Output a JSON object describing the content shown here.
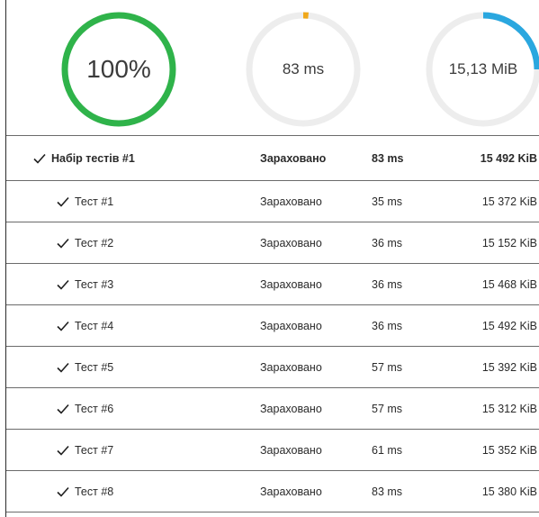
{
  "summary": {
    "tests": {
      "label": "100%",
      "fraction": 1.0,
      "color": "#2fb34a"
    },
    "time": {
      "label": "83 ms",
      "fraction": 0.015,
      "color": "#f0a81a"
    },
    "memory": {
      "label": "15,13 MiB",
      "fraction": 0.25,
      "color": "#2aa7df"
    },
    "track_color": "#ededed"
  },
  "group": {
    "icon": "check-icon",
    "name": "Набір тестів #1",
    "status": "Зараховано",
    "time": "83 ms",
    "memory": "15 492 KiB"
  },
  "tests": [
    {
      "icon": "check-icon",
      "name": "Тест #1",
      "status": "Зараховано",
      "time": "35 ms",
      "memory": "15 372 KiB"
    },
    {
      "icon": "check-icon",
      "name": "Тест #2",
      "status": "Зараховано",
      "time": "36 ms",
      "memory": "15 152 KiB"
    },
    {
      "icon": "check-icon",
      "name": "Тест #3",
      "status": "Зараховано",
      "time": "36 ms",
      "memory": "15 468 KiB"
    },
    {
      "icon": "check-icon",
      "name": "Тест #4",
      "status": "Зараховано",
      "time": "36 ms",
      "memory": "15 492 KiB"
    },
    {
      "icon": "check-icon",
      "name": "Тест #5",
      "status": "Зараховано",
      "time": "57 ms",
      "memory": "15 392 KiB"
    },
    {
      "icon": "check-icon",
      "name": "Тест #6",
      "status": "Зараховано",
      "time": "57 ms",
      "memory": "15 312 KiB"
    },
    {
      "icon": "check-icon",
      "name": "Тест #7",
      "status": "Зараховано",
      "time": "61 ms",
      "memory": "15 352 KiB"
    },
    {
      "icon": "check-icon",
      "name": "Тест #8",
      "status": "Зараховано",
      "time": "83 ms",
      "memory": "15 380 KiB"
    }
  ]
}
